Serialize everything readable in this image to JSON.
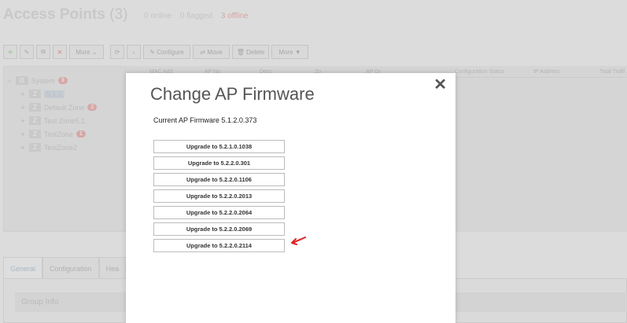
{
  "page": {
    "title": "Access Points",
    "count": "(3)",
    "stats": {
      "online": "0 online",
      "flagged": "0 flagged",
      "offline": "3 offline"
    },
    "offline_color": "#d4a6a6"
  },
  "toolbar_left": {
    "add_icon": "plus-icon",
    "edit_icon": "pencil-icon",
    "clone_icon": "copy-icon",
    "delete_icon": "x-icon",
    "more_label": "More"
  },
  "toolbar_right": {
    "refresh_icon": "refresh-icon",
    "collapse_icon": "chevron-left-icon",
    "configure_label": "Configure",
    "move_label": "Move",
    "delete_label": "Delete",
    "more_label": "More ▼"
  },
  "tree": {
    "root": {
      "tag": "D",
      "label": "System",
      "badge": "3"
    },
    "items": [
      {
        "tag": "Z",
        "label": "5.1.2",
        "badge": ""
      },
      {
        "tag": "Z",
        "label": "Default Zone",
        "badge": "2"
      },
      {
        "tag": "Z",
        "label": "Test Zone5.1",
        "badge": ""
      },
      {
        "tag": "Z",
        "label": "TestZone",
        "badge": "1"
      },
      {
        "tag": "Z",
        "label": "TestZone2",
        "badge": ""
      }
    ]
  },
  "grid": {
    "columns": [
      "MAC Add",
      "AP Na",
      "Desc",
      "Zo",
      "AP Gr",
      "Configuration Status",
      "IP Address",
      "Total Traffi"
    ]
  },
  "tabs": [
    "General",
    "Configuration",
    "Hea"
  ],
  "group_info_label": "Group Info",
  "modal": {
    "title": "Change AP Firmware",
    "close_icon": "close-icon",
    "current_firmware": "Current AP Firmware 5.1.2.0.373",
    "upgrades": [
      "Upgrade to 5.2.1.0.1038",
      "Upgrade to 5.2.2.0.301",
      "Upgrade to 5.2.2.0.1106",
      "Upgrade to 5.2.2.0.2013",
      "Upgrade to 5.2.2.0.2064",
      "Upgrade to 5.2.2.0.2069",
      "Upgrade to 5.2.2.0.2114"
    ],
    "arrow_color": "#e02020"
  }
}
